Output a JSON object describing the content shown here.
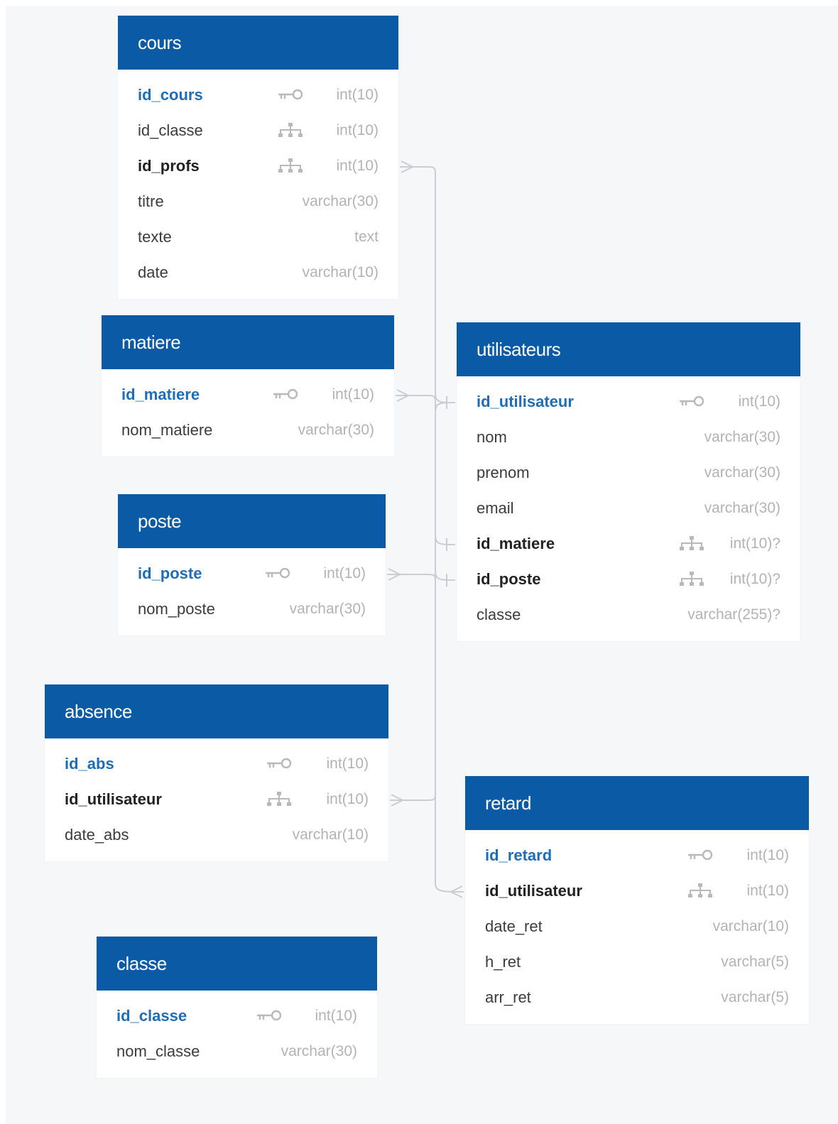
{
  "diagram": {
    "tables": [
      {
        "id": "cours",
        "name": "cours",
        "columns": [
          {
            "name": "id_cours",
            "type": "int(10)",
            "key": "pk"
          },
          {
            "name": "id_classe",
            "type": "int(10)",
            "key": "ref"
          },
          {
            "name": "id_profs",
            "type": "int(10)",
            "key": "fk"
          },
          {
            "name": "titre",
            "type": "varchar(30)",
            "key": ""
          },
          {
            "name": "texte",
            "type": "text",
            "key": ""
          },
          {
            "name": "date",
            "type": "varchar(10)",
            "key": ""
          }
        ]
      },
      {
        "id": "matiere",
        "name": "matiere",
        "columns": [
          {
            "name": "id_matiere",
            "type": "int(10)",
            "key": "pk"
          },
          {
            "name": "nom_matiere",
            "type": "varchar(30)",
            "key": ""
          }
        ]
      },
      {
        "id": "poste",
        "name": "poste",
        "columns": [
          {
            "name": "id_poste",
            "type": "int(10)",
            "key": "pk"
          },
          {
            "name": "nom_poste",
            "type": "varchar(30)",
            "key": ""
          }
        ]
      },
      {
        "id": "absence",
        "name": "absence",
        "columns": [
          {
            "name": "id_abs",
            "type": "int(10)",
            "key": "pk"
          },
          {
            "name": "id_utilisateur",
            "type": "int(10)",
            "key": "fk"
          },
          {
            "name": "date_abs",
            "type": "varchar(10)",
            "key": ""
          }
        ]
      },
      {
        "id": "classe",
        "name": "classe",
        "columns": [
          {
            "name": "id_classe",
            "type": "int(10)",
            "key": "pk"
          },
          {
            "name": "nom_classe",
            "type": "varchar(30)",
            "key": ""
          }
        ]
      },
      {
        "id": "utilisateurs",
        "name": "utilisateurs",
        "columns": [
          {
            "name": "id_utilisateur",
            "type": "int(10)",
            "key": "pk"
          },
          {
            "name": "nom",
            "type": "varchar(30)",
            "key": ""
          },
          {
            "name": "prenom",
            "type": "varchar(30)",
            "key": ""
          },
          {
            "name": "email",
            "type": "varchar(30)",
            "key": ""
          },
          {
            "name": "id_matiere",
            "type": "int(10)?",
            "key": "fk"
          },
          {
            "name": "id_poste",
            "type": "int(10)?",
            "key": "fk"
          },
          {
            "name": "classe",
            "type": "varchar(255)?",
            "key": ""
          }
        ]
      },
      {
        "id": "retard",
        "name": "retard",
        "columns": [
          {
            "name": "id_retard",
            "type": "int(10)",
            "key": "pk"
          },
          {
            "name": "id_utilisateur",
            "type": "int(10)",
            "key": "fk"
          },
          {
            "name": "date_ret",
            "type": "varchar(10)",
            "key": ""
          },
          {
            "name": "h_ret",
            "type": "varchar(5)",
            "key": ""
          },
          {
            "name": "arr_ret",
            "type": "varchar(5)",
            "key": ""
          }
        ]
      }
    ],
    "relationships": [
      {
        "from": "cours.id_profs",
        "to": "utilisateurs.id_utilisateur",
        "from_end": "many",
        "to_end": "one"
      },
      {
        "from": "absence.id_utilisateur",
        "to": "utilisateurs.id_utilisateur",
        "from_end": "many",
        "to_end": "one"
      },
      {
        "from": "retard.id_utilisateur",
        "to": "utilisateurs.id_utilisateur",
        "from_end": "many",
        "to_end": "one"
      },
      {
        "from": "matiere.id_matiere",
        "to": "utilisateurs.id_matiere",
        "from_end": "many",
        "to_end": "one"
      },
      {
        "from": "poste.id_poste",
        "to": "utilisateurs.id_poste",
        "from_end": "many",
        "to_end": "one"
      }
    ],
    "colors": {
      "header": "#0b5aa6",
      "header_text": "#ffffff",
      "primary_key": "#1f6db7",
      "foreign_key": "#222222",
      "column_text": "#3c3c3c",
      "type_text": "#b3b3b3",
      "connector": "#c9ced3",
      "canvas": "#f6f7f8"
    },
    "icons": {
      "pk": "key-icon",
      "ref": "relation-icon",
      "fk": "relation-icon"
    }
  }
}
